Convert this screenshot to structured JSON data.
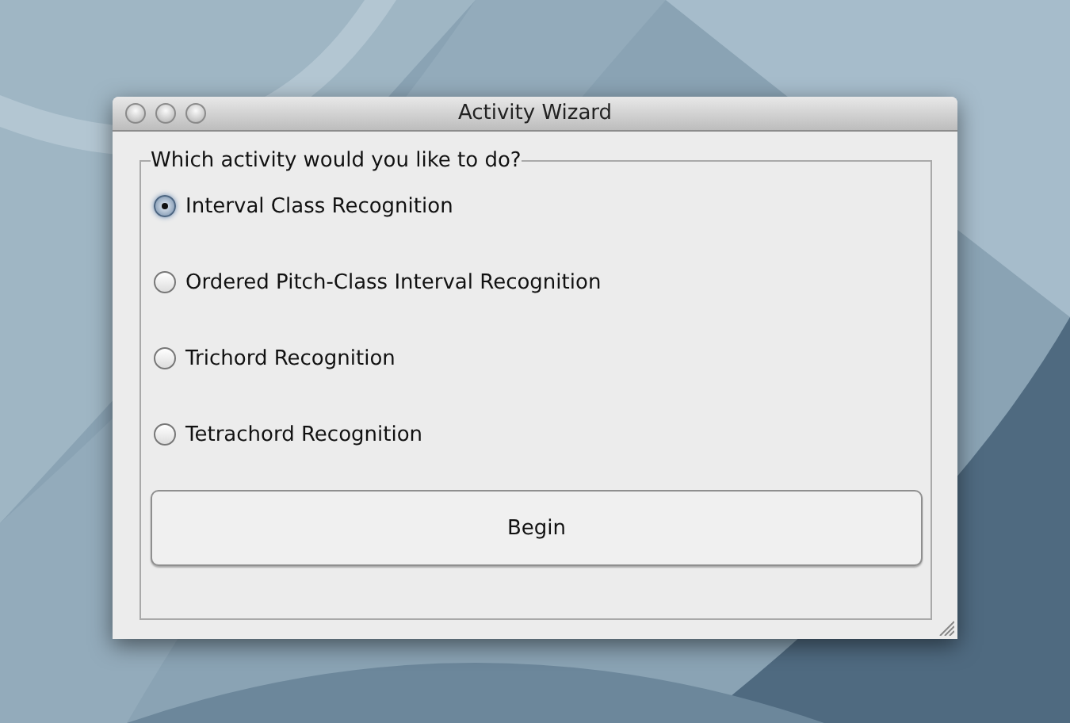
{
  "window": {
    "title": "Activity Wizard"
  },
  "group": {
    "legend": "Which activity would you like to do?"
  },
  "options": [
    {
      "label": "Interval Class Recognition",
      "selected": true
    },
    {
      "label": "Ordered Pitch-Class Interval Recognition",
      "selected": false
    },
    {
      "label": "Trichord Recognition",
      "selected": false
    },
    {
      "label": "Tetrachord Recognition",
      "selected": false
    }
  ],
  "buttons": [
    "Begin"
  ]
}
